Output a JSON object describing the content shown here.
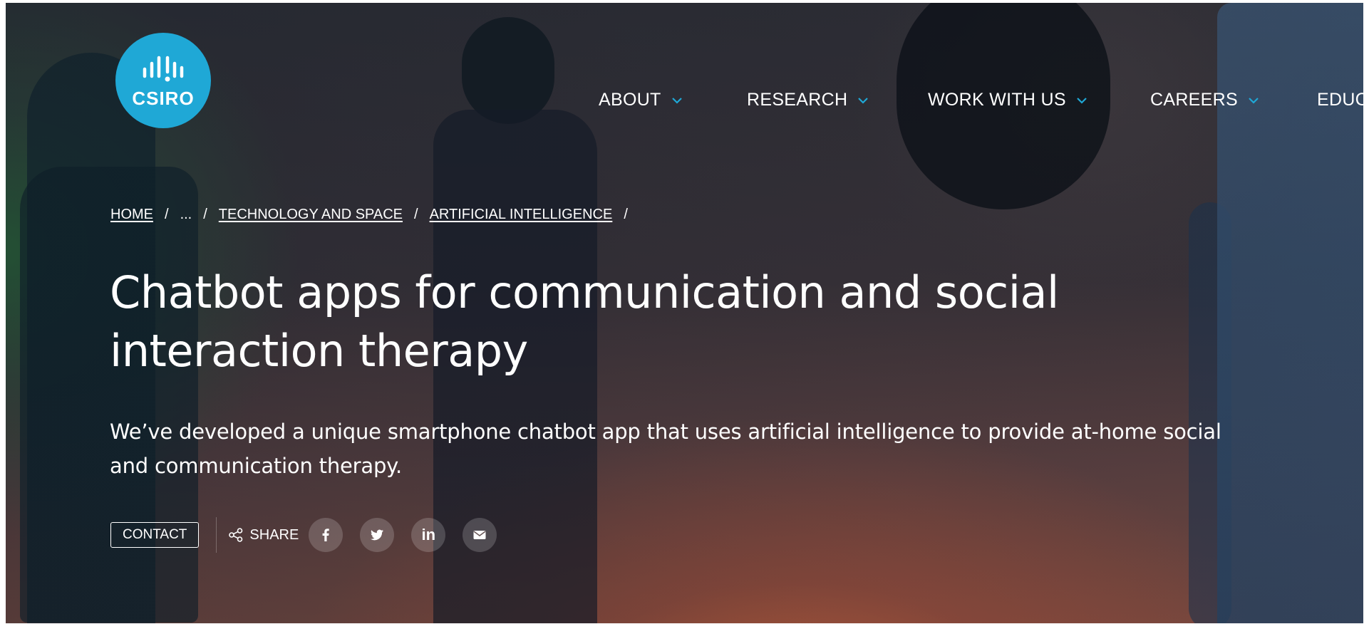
{
  "logo": {
    "text": "CSIRO",
    "color": "#1fa8d6"
  },
  "nav": {
    "items": [
      {
        "label": "ABOUT"
      },
      {
        "label": "RESEARCH"
      },
      {
        "label": "WORK WITH US"
      },
      {
        "label": "CAREERS"
      },
      {
        "label": "EDUC"
      }
    ],
    "chevron_color": "#1fa8d6"
  },
  "breadcrumb": {
    "items": [
      {
        "label": "HOME"
      },
      {
        "label": "..."
      },
      {
        "label": "TECHNOLOGY AND SPACE"
      },
      {
        "label": "ARTIFICIAL INTELLIGENCE"
      }
    ],
    "separator": "/"
  },
  "hero": {
    "title": "Chatbot apps for communication and social interaction therapy",
    "lead": "We’ve developed a unique smartphone chatbot app that uses artificial intelligence to provide at-home social and communication therapy."
  },
  "actions": {
    "contact_label": "CONTACT",
    "share_label": "SHARE",
    "social": [
      {
        "icon": "facebook-icon"
      },
      {
        "icon": "twitter-icon"
      },
      {
        "icon": "linkedin-icon",
        "text": "in"
      },
      {
        "icon": "email-icon"
      }
    ]
  }
}
